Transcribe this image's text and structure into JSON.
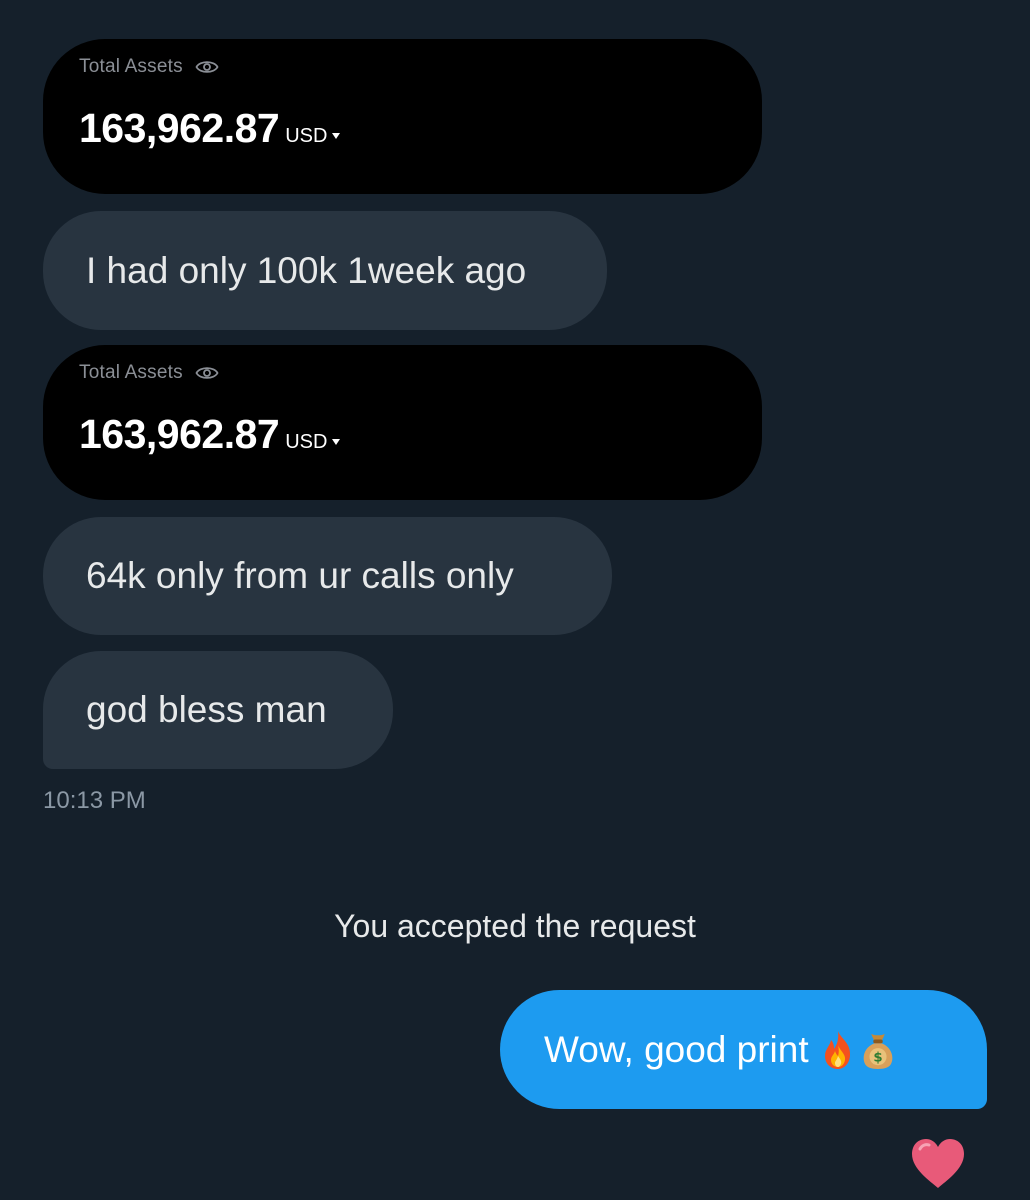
{
  "thread": {
    "cards": [
      {
        "label": "Total Assets",
        "amount": "163,962.87",
        "currency": "USD"
      },
      {
        "label": "Total Assets",
        "amount": "163,962.87",
        "currency": "USD"
      }
    ],
    "incoming_messages": [
      "I had only 100k 1week ago",
      "64k only from ur calls only",
      "god bless man"
    ],
    "timestamp": "10:13 PM",
    "system_note": "You accepted the request",
    "outgoing_message": {
      "text": "Wow, good print",
      "emojis": [
        "fire-icon",
        "money-bag-icon"
      ]
    },
    "reaction": "red-heart-icon"
  },
  "colors": {
    "background": "#15202b",
    "incoming_bubble": "#283440",
    "outgoing_bubble": "#1d9bf0",
    "card": "#000000"
  }
}
